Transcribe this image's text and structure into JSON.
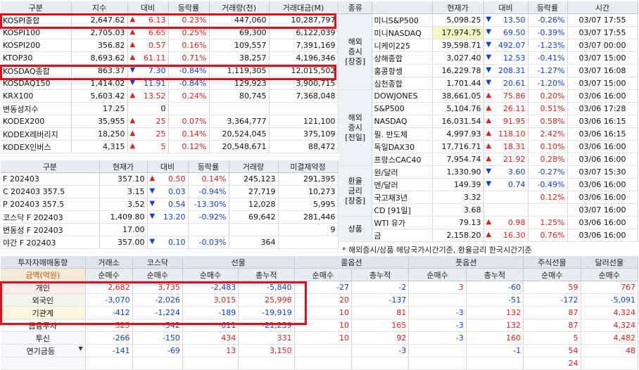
{
  "index_table": {
    "headers": [
      "구분",
      "지수",
      "대비",
      "등락률",
      "거래량(천)",
      "거래대금(M)"
    ],
    "rows": [
      {
        "name": "KOSPI종합",
        "price": "2,647.62",
        "dir": "up",
        "chg": "6.13",
        "rate": "0.23%",
        "vol": "447,060",
        "amt": "10,287,797"
      },
      {
        "name": "KOSPI100",
        "price": "2,705.03",
        "dir": "up",
        "chg": "6.65",
        "rate": "0.25%",
        "vol": "69,300",
        "amt": "6,122,039"
      },
      {
        "name": "KOSPI200",
        "price": "356.82",
        "dir": "up",
        "chg": "0.57",
        "rate": "0.16%",
        "vol": "109,557",
        "amt": "7,391,169"
      },
      {
        "name": "KTOP30",
        "price": "8,693.62",
        "dir": "up",
        "chg": "61.11",
        "rate": "0.71%",
        "vol": "38,257",
        "amt": "4,196,346"
      },
      {
        "name": "KOSDAQ종합",
        "price": "863.37",
        "dir": "dn",
        "chg": "7.30",
        "rate": "-0.84%",
        "vol": "1,119,305",
        "amt": "12,015,502"
      },
      {
        "name": "KOSDAQ150",
        "price": "1,414.02",
        "dir": "dn",
        "chg": "11.91",
        "rate": "-0.84%",
        "vol": "129,923",
        "amt": "3,900,715"
      },
      {
        "name": "KRX100",
        "price": "5,603.42",
        "dir": "up",
        "chg": "13.52",
        "rate": "0.24%",
        "vol": "80,745",
        "amt": "7,368,048"
      },
      {
        "name": "변동성지수",
        "price": "17.25",
        "dir": "",
        "chg": "0",
        "rate": "",
        "vol": "",
        "amt": ""
      },
      {
        "name": "KODEX200",
        "price": "35,955",
        "dir": "up",
        "chg": "25",
        "rate": "0.07%",
        "vol": "3,364,777",
        "amt": "121,100"
      },
      {
        "name": "KODEX레버리지",
        "price": "18,250",
        "dir": "up",
        "chg": "25",
        "rate": "0.14%",
        "vol": "20,524,045",
        "amt": "375,109"
      },
      {
        "name": "KODEX인버스",
        "price": "4,315",
        "dir": "up",
        "chg": "5",
        "rate": "0.12%",
        "vol": "20,548,671",
        "amt": "88,472"
      }
    ]
  },
  "futures_table": {
    "headers": [
      "구분",
      "현재가",
      "대비",
      "등락률",
      "거래량",
      "미결제약정"
    ],
    "rows": [
      {
        "name": "F 202403",
        "price": "357.10",
        "dir": "up",
        "chg": "0.50",
        "rate": "0.14%",
        "vol": "245,123",
        "oi": "291,395"
      },
      {
        "name": "C 202403 357.5",
        "price": "3.15",
        "dir": "dn",
        "chg": "0.03",
        "rate": "-0.94%",
        "vol": "27,719",
        "oi": "10,273"
      },
      {
        "name": "P 202403 357.5",
        "price": "3.52",
        "dir": "dn",
        "chg": "0.54",
        "rate": "-13.30%",
        "vol": "12,028",
        "oi": "5,995"
      },
      {
        "name": "코스닥 F 202403",
        "price": "1,409.80",
        "dir": "dn",
        "chg": "13.20",
        "rate": "-0.92%",
        "vol": "69,642",
        "oi": "281,446"
      },
      {
        "name": "변동성 F 202403",
        "price": "17.00",
        "dir": "",
        "chg": "",
        "rate": "",
        "vol": "",
        "oi": "9"
      },
      {
        "name": "야간  F 202403",
        "price": "357.00",
        "dir": "dn",
        "chg": "0.10",
        "rate": "-0.03%",
        "vol": "364",
        "oi": ""
      }
    ]
  },
  "world_table": {
    "headers": [
      "종류",
      "",
      "현재가",
      "대비",
      "등락률",
      "시간"
    ],
    "groups": [
      {
        "label": "해외\n증시\n[장중]",
        "rows": [
          {
            "name": "미니S&P500",
            "price": "5,098.25",
            "dir": "dn",
            "chg": "13.50",
            "rate": "-0.26%",
            "time": "03/07 17:55"
          },
          {
            "name": "미니NASDAQ",
            "price": "17,974.75",
            "dir": "dn",
            "chg": "69.50",
            "rate": "-0.39%",
            "time": "03/07 17:55",
            "hl": true
          },
          {
            "name": "니케이225",
            "price": "39,598.71",
            "dir": "dn",
            "chg": "492.07",
            "rate": "-1.23%",
            "time": "03/07 00:00"
          },
          {
            "name": "상해종합",
            "price": "3,027.40",
            "dir": "dn",
            "chg": "12.53",
            "rate": "-0.41%",
            "time": "03/07 15:00"
          },
          {
            "name": "홍콩항셍",
            "price": "16,229.78",
            "dir": "dn",
            "chg": "208.31",
            "rate": "-1.27%",
            "time": "03/07 16:08"
          },
          {
            "name": "심천종합",
            "price": "1,701.44",
            "dir": "dn",
            "chg": "20.61",
            "rate": "-1.20%",
            "time": "03/07 15:00"
          }
        ]
      },
      {
        "label": "해외\n증시\n[전일]",
        "rows": [
          {
            "name": "DOWJONES",
            "price": "38,661.05",
            "dir": "up",
            "chg": "75.86",
            "rate": "0.20%",
            "time": "03/06 16:00"
          },
          {
            "name": "S&P500",
            "price": "5,104.76",
            "dir": "up",
            "chg": "26.11",
            "rate": "0.51%",
            "time": "03/06 17:28"
          },
          {
            "name": "NASDAQ",
            "price": "16,031.54",
            "dir": "up",
            "chg": "91.95",
            "rate": "0.58%",
            "time": "03/06 16:15"
          },
          {
            "name": "필. 반도체",
            "price": "4,997.93",
            "dir": "up",
            "chg": "118.10",
            "rate": "2.42%",
            "time": "03/06 16:15"
          },
          {
            "name": "독일DAX30",
            "price": "17,716.71",
            "dir": "up",
            "chg": "18.31",
            "rate": "0.10%",
            "time": "03/06 16:00"
          },
          {
            "name": "프랑스CAC40",
            "price": "7,954.74",
            "dir": "up",
            "chg": "21.92",
            "rate": "0.28%",
            "time": "03/06 16:00"
          }
        ]
      },
      {
        "label": "환율\n금리\n[장중]",
        "rows": [
          {
            "name": "원/달러",
            "price": "1,330.90",
            "dir": "dn",
            "chg": "3.60",
            "rate": "-0.27%",
            "time": "03/07 15:30"
          },
          {
            "name": "엔/달러",
            "price": "149.39",
            "dir": "dn",
            "chg": "0.74",
            "rate": "-0.49%",
            "time": "03/06 16:00"
          },
          {
            "name": "국고채3년",
            "price": "3.32",
            "dir": "",
            "chg": "",
            "rate": "0.12%",
            "time": "03/06 16:00"
          },
          {
            "name": "CD [91일]",
            "price": "3.68",
            "dir": "",
            "chg": "",
            "rate": "",
            "time": "03/07 16:00"
          }
        ]
      },
      {
        "label": "상품",
        "rows": [
          {
            "name": "WTI 유가",
            "price": "79.13",
            "dir": "up",
            "chg": "0.98",
            "rate": "1.25%",
            "time": "03/06 16:00"
          },
          {
            "name": "금",
            "price": "2,158.20",
            "dir": "up",
            "chg": "16.30",
            "rate": "0.76%",
            "time": "03/06 16:00"
          }
        ]
      }
    ],
    "note": "* 해외증시/상품 해당국가시간기준, 환율금리 한국시간기준"
  },
  "investor_table": {
    "title": "투자자매매동향",
    "subtitle": "금액(억원)",
    "groups": [
      "거래소",
      "코스닥",
      "선물",
      "콜옵션",
      "풋옵션",
      "주식선물",
      "달러선물"
    ],
    "subheads": [
      "순매수",
      "순매수",
      "순매수",
      "총누적",
      "순매수",
      "총누적",
      "순매수",
      "총누적",
      "순매수",
      "순매수"
    ],
    "rows": [
      {
        "name": "개인",
        "v": [
          "2,682",
          "3,735",
          "-2,483",
          "-5,840",
          "-27",
          "-2",
          "3",
          "-60",
          "59",
          "767"
        ]
      },
      {
        "name": "외국인",
        "v": [
          "-3,070",
          "-2,026",
          "3,015",
          "25,998",
          "20",
          "-137",
          "",
          "-51",
          "-172",
          "-5,091"
        ]
      },
      {
        "name": "기관계",
        "v": [
          "-412",
          "-1,224",
          "-189",
          "-19,919",
          "10",
          "81",
          "-3",
          "132",
          "87",
          "4,324"
        ]
      },
      {
        "name": "금융투자",
        "v": [
          "325",
          "-542",
          "-611",
          "-21,239",
          "10",
          "165",
          "-3",
          "132",
          "87",
          "4,324"
        ]
      },
      {
        "name": "투신",
        "v": [
          "-266",
          "-150",
          "434",
          "331",
          "10",
          "92",
          "-3",
          "160",
          "5",
          "4,482"
        ]
      },
      {
        "name": "연기금등",
        "v": [
          "-141",
          "-69",
          "13",
          "3,150",
          "",
          "-3",
          "",
          "-1",
          "54",
          "48"
        ]
      },
      {
        "name": "",
        "v": [
          "",
          "",
          "",
          "",
          "",
          "",
          "",
          "",
          "24",
          ""
        ]
      }
    ]
  }
}
